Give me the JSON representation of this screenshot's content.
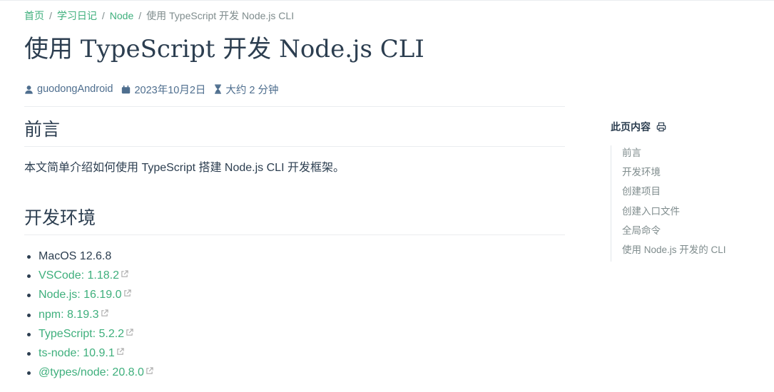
{
  "breadcrumb": [
    {
      "label": "首页",
      "active": false
    },
    {
      "label": "学习日记",
      "active": false
    },
    {
      "label": "Node",
      "active": false
    },
    {
      "label": "使用 TypeScript 开发 Node.js CLI",
      "active": true
    }
  ],
  "page": {
    "title": "使用 TypeScript 开发 Node.js CLI"
  },
  "meta": {
    "author": "guodongAndroid",
    "date": "2023年10月2日",
    "reading_time": "大约 2 分钟"
  },
  "sections": {
    "intro": {
      "heading": "前言",
      "text": "本文简单介绍如何使用 TypeScript 搭建 Node.js CLI 开发框架。"
    },
    "env": {
      "heading": "开发环境",
      "items": [
        {
          "label": "MacOS 12.6.8",
          "link": false
        },
        {
          "label": "VSCode: 1.18.2",
          "link": true
        },
        {
          "label": "Node.js: 16.19.0",
          "link": true
        },
        {
          "label": "npm: 8.19.3",
          "link": true
        },
        {
          "label": "TypeScript: 5.2.2",
          "link": true
        },
        {
          "label": "ts-node: 10.9.1",
          "link": true
        },
        {
          "label": "@types/node: 20.8.0",
          "link": true
        }
      ]
    }
  },
  "toc": {
    "title": "此页内容",
    "items": [
      "前言",
      "开发环境",
      "创建项目",
      "创建入口文件",
      "全局命令",
      "使用 Node.js 开发的 CLI"
    ]
  },
  "colors": {
    "accent": "#3eaf7c",
    "text": "#2c3e50",
    "muted": "#7f8c8d"
  },
  "icons": {
    "author": "person-icon",
    "date": "calendar-icon",
    "reading_time": "hourglass-icon",
    "print": "print-icon",
    "external": "external-link-icon"
  }
}
